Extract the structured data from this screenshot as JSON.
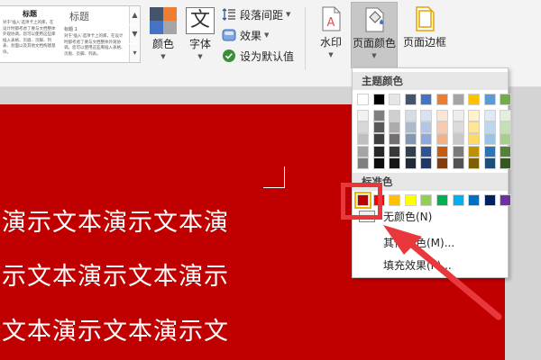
{
  "ribbon": {
    "style_gallery": {
      "thumb1_title": "标题",
      "thumb1_body": "对于'插入'选项卡上的库，在设计时都考虑了要与文档整体外观协调。您可以使用这些库插入表格、页眉、页脚、列表、封面以及其他文档构建基块。",
      "thumb2_title": "标题",
      "thumb2_sub": "标题 1",
      "thumb2_body": "对于'插入'选项卡上的库，在设计时都考虑了要与文档整体外观协调。您可以使用这些库插入表格、页眉、页脚、列表。"
    },
    "colors_label": "颜色",
    "fonts_label": "字体",
    "fonts_glyph": "文",
    "paragraph_spacing_label": "段落间距",
    "effects_label": "效果",
    "set_default_label": "设为默认值",
    "watermark_label": "水印",
    "page_color_label": "页面颜色",
    "page_border_label": "页面边框",
    "colors_icon": [
      "#44546a",
      "#ed7d31",
      "#4472c4",
      "#a5a5a5"
    ]
  },
  "document": {
    "page_color": "#c00000",
    "lines": [
      "演示文本演示文本演",
      "示文本演示文本演示",
      "文本演示文本演示文"
    ]
  },
  "page_color_menu": {
    "theme_colors_header": "主题颜色",
    "standard_colors_header": "标准色",
    "no_color_label": "无颜色(N)",
    "more_colors_label": "其他颜色(M)...",
    "fill_effects_label": "填充效果(F)...",
    "theme_base": [
      "#ffffff",
      "#000000",
      "#e7e6e6",
      "#44546a",
      "#4472c4",
      "#ed7d31",
      "#a5a5a5",
      "#ffc000",
      "#5b9bd5",
      "#70ad47"
    ],
    "theme_shades": [
      [
        "#f2f2f2",
        "#7f7f7f",
        "#d0cece",
        "#d6dce4",
        "#d9e2f3",
        "#fbe5d5",
        "#ededed",
        "#fff2cc",
        "#deebf6",
        "#e2efd9"
      ],
      [
        "#d8d8d8",
        "#595959",
        "#aeabab",
        "#adb9ca",
        "#b4c6e7",
        "#f7cbac",
        "#dbdbdb",
        "#fee599",
        "#bdd7ee",
        "#c5e0b3"
      ],
      [
        "#bfbfbf",
        "#3f3f3f",
        "#757070",
        "#8496b0",
        "#8eaadb",
        "#f4b183",
        "#c9c9c9",
        "#ffd965",
        "#9cc3e5",
        "#a8d08d"
      ],
      [
        "#a5a5a5",
        "#262626",
        "#3a3838",
        "#323f4f",
        "#2f5496",
        "#c55a11",
        "#7b7b7b",
        "#bf9000",
        "#2e75b5",
        "#538135"
      ],
      [
        "#7f7f7f",
        "#0c0c0c",
        "#171616",
        "#222a35",
        "#1f3864",
        "#833c0b",
        "#525252",
        "#7f6000",
        "#1e4e79",
        "#375623"
      ]
    ],
    "standard": [
      "#c00000",
      "#ff0000",
      "#ffc000",
      "#ffff00",
      "#92d050",
      "#00b050",
      "#00b0f0",
      "#0070c0",
      "#002060",
      "#7030a0"
    ]
  },
  "annotation": {
    "highlight_color": "#e8383b"
  }
}
